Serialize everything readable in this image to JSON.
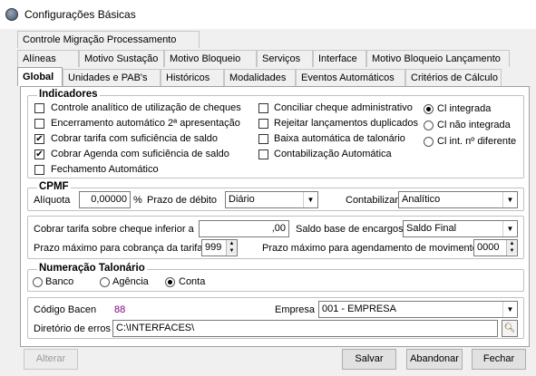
{
  "window": {
    "title": "Configurações Básicas"
  },
  "tabs": {
    "row1": [
      "Controle Migração Processamento"
    ],
    "row2": [
      "Alíneas",
      "Motivo Sustação",
      "Motivo Bloqueio",
      "Serviços",
      "Interface",
      "Motivo Bloqueio Lançamento"
    ],
    "row3": [
      "Global",
      "Unidades e PAB's",
      "Históricos",
      "Modalidades",
      "Eventos Automáticos",
      "Critérios de Cálculo"
    ],
    "active": "Global"
  },
  "indicadores": {
    "legend": "Indicadores",
    "left": [
      {
        "label": "Controle analítico de utilização de cheques",
        "checked": false
      },
      {
        "label": "Encerramento automático 2ª apresentação",
        "checked": false
      },
      {
        "label": "Cobrar tarifa com suficiência de saldo",
        "checked": true
      },
      {
        "label": "Cobrar Agenda com suficiência de saldo",
        "checked": true
      },
      {
        "label": "Fechamento Automático",
        "checked": false
      }
    ],
    "middle": [
      {
        "label": "Conciliar cheque administrativo",
        "checked": false
      },
      {
        "label": "Rejeitar lançamentos duplicados",
        "checked": false
      },
      {
        "label": "Baixa automática de talonário",
        "checked": false
      },
      {
        "label": "Contabilização Automática",
        "checked": false
      }
    ],
    "radios": [
      {
        "label": "Cl integrada",
        "selected": true
      },
      {
        "label": "Cl não integrada",
        "selected": false
      },
      {
        "label": "Cl int. nº diferente",
        "selected": false
      }
    ]
  },
  "cpmf": {
    "legend": "CPMF",
    "aliquota_label": "Alíquota",
    "aliquota_value": "0,00000",
    "percent": "%",
    "prazo_label": "Prazo de débito",
    "prazo_value": "Diário",
    "contabilizar_label": "Contabilizar",
    "contabilizar_value": "Analítico"
  },
  "cobranca": {
    "tarifa_label": "Cobrar tarifa sobre cheque inferior a",
    "tarifa_value": ",00",
    "saldo_label": "Saldo base de encargos",
    "saldo_value": "Saldo Final",
    "prazo_tarifa_label": "Prazo máximo para cobrança da tarifa",
    "prazo_tarifa_value": "999",
    "prazo_agend_label": "Prazo máximo para agendamento de movimento",
    "prazo_agend_value": "0000"
  },
  "numeracao": {
    "legend": "Numeração Talonário",
    "options": [
      {
        "label": "Banco",
        "selected": false
      },
      {
        "label": "Agência",
        "selected": false
      },
      {
        "label": "Conta",
        "selected": true
      }
    ]
  },
  "bacen": {
    "codigo_label": "Código Bacen",
    "codigo_value": "88",
    "empresa_label": "Empresa",
    "empresa_value": "001 - EMPRESA",
    "diretorio_label": "Diretório de erros",
    "diretorio_value": "C:\\INTERFACES\\"
  },
  "buttons": {
    "alterar": "Alterar",
    "salvar": "Salvar",
    "abandonar": "Abandonar",
    "fechar": "Fechar"
  }
}
